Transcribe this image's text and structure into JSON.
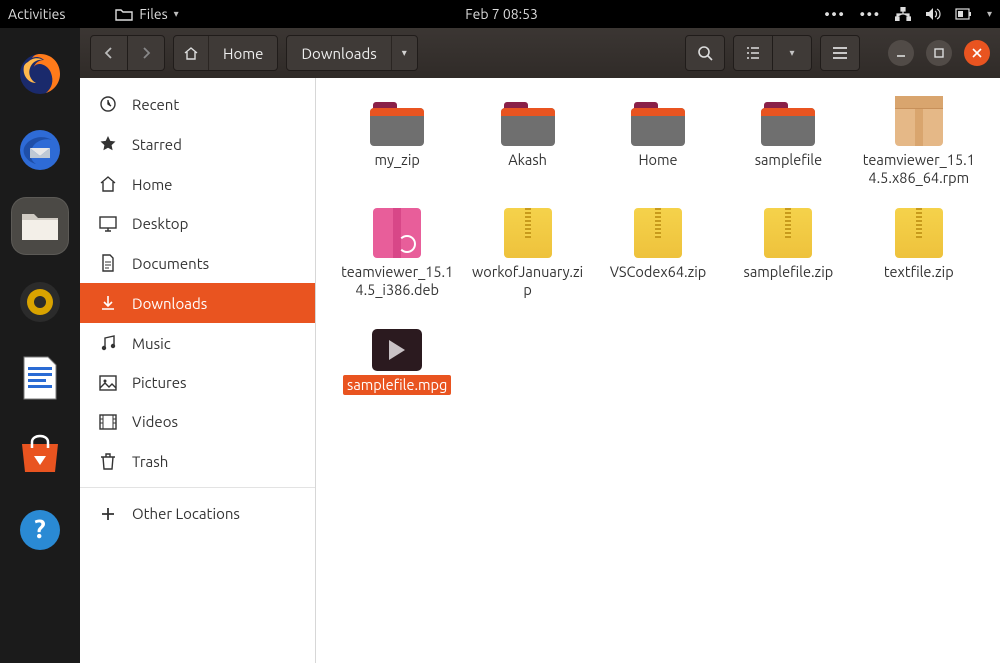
{
  "toppanel": {
    "activities": "Activities",
    "app_label": "Files",
    "datetime": "Feb 7  08:53"
  },
  "pathbar": {
    "home": "Home",
    "segments": [
      "Downloads"
    ]
  },
  "sidebar": [
    {
      "icon": "clock",
      "label": "Recent"
    },
    {
      "icon": "star",
      "label": "Starred"
    },
    {
      "icon": "home",
      "label": "Home"
    },
    {
      "icon": "desktop",
      "label": "Desktop"
    },
    {
      "icon": "docs",
      "label": "Documents"
    },
    {
      "icon": "download",
      "label": "Downloads",
      "active": true
    },
    {
      "icon": "music",
      "label": "Music"
    },
    {
      "icon": "pictures",
      "label": "Pictures"
    },
    {
      "icon": "videos",
      "label": "Videos"
    },
    {
      "icon": "trash",
      "label": "Trash"
    },
    {
      "sep": true
    },
    {
      "icon": "plus",
      "label": "Other Locations"
    }
  ],
  "files": [
    {
      "type": "folder",
      "name": "my_zip"
    },
    {
      "type": "folder",
      "name": "Akash"
    },
    {
      "type": "folder",
      "name": "Home"
    },
    {
      "type": "folder",
      "name": "samplefile"
    },
    {
      "type": "rpm",
      "name": "teamviewer_15.14.5.x86_64.rpm"
    },
    {
      "type": "deb",
      "name": "teamviewer_15.14.5_i386.deb"
    },
    {
      "type": "zip",
      "name": "workofJanuary.zip"
    },
    {
      "type": "zip",
      "name": "VSCodex64.zip"
    },
    {
      "type": "zip",
      "name": "samplefile.zip"
    },
    {
      "type": "zip",
      "name": "textfile.zip"
    },
    {
      "type": "video",
      "name": "samplefile.mpg",
      "selected": true
    }
  ]
}
